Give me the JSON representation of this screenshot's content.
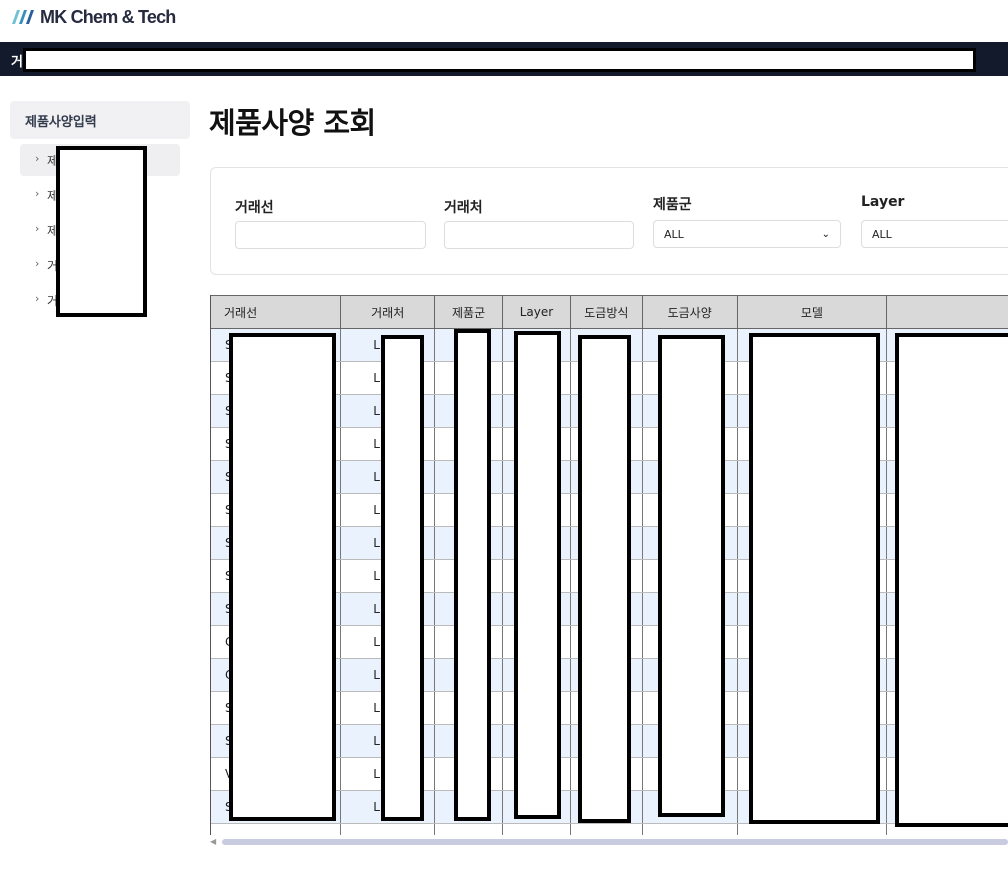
{
  "brand": {
    "name": "MK Chem & Tech",
    "accent": "#3a8fc0"
  },
  "nav": {
    "first_char": "거"
  },
  "sidebar": {
    "header": "제품사양입력",
    "items": [
      {
        "label": "제"
      },
      {
        "label": "제"
      },
      {
        "label": "제"
      },
      {
        "label": "거"
      },
      {
        "label": "거"
      }
    ]
  },
  "page": {
    "title": "제품사양 조회"
  },
  "filters": {
    "customer_line": {
      "label": "거래선",
      "value": ""
    },
    "customer": {
      "label": "거래처",
      "value": ""
    },
    "product_group": {
      "label": "제품군",
      "selected": "ALL"
    },
    "layer": {
      "label": "Layer",
      "selected": "ALL"
    }
  },
  "table": {
    "columns": [
      "거래선",
      "거래처",
      "제품군",
      "Layer",
      "도금방식",
      "도금사양",
      "모델",
      ""
    ],
    "rows": [
      [
        "S",
        "L"
      ],
      [
        "S",
        "L"
      ],
      [
        "S",
        "L"
      ],
      [
        "S",
        "L"
      ],
      [
        "S",
        "L"
      ],
      [
        "S",
        "L"
      ],
      [
        "S",
        "L"
      ],
      [
        "S",
        "L"
      ],
      [
        "S",
        "L"
      ],
      [
        "C",
        "L"
      ],
      [
        "C",
        "L"
      ],
      [
        "S",
        "L"
      ],
      [
        "S",
        "L"
      ],
      [
        "V",
        "L"
      ],
      [
        "S",
        "L"
      ],
      [
        "",
        ""
      ]
    ]
  },
  "colors": {
    "navbar": "#131a2b",
    "row_alt": "#eaf3fd",
    "header": "#d9d9d9"
  }
}
